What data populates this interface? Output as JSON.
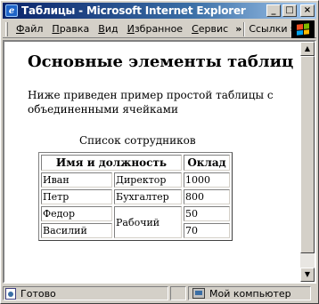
{
  "window": {
    "title": "Таблицы - Microsoft Internet Explorer",
    "minimize": "_",
    "maximize": "□",
    "close": "×"
  },
  "menu": {
    "items": [
      {
        "underline": "Ф",
        "rest": "айл"
      },
      {
        "underline": "П",
        "rest": "равка"
      },
      {
        "underline": "В",
        "rest": "ид"
      },
      {
        "underline": "И",
        "rest": "збранное"
      },
      {
        "underline": "С",
        "rest": "ервис"
      }
    ],
    "chevron": "»",
    "links_label": "Ссылки",
    "links_chevron": "»"
  },
  "page": {
    "heading": "Основные элементы таблиц",
    "intro": "Ниже приведен пример простой таблицы с объединенными ячейками",
    "table_caption": "Список сотрудников",
    "headers": [
      "Имя и должность",
      "Оклад"
    ],
    "rows": [
      {
        "name": "Иван",
        "position": "Директор",
        "salary": "1000"
      },
      {
        "name": "Петр",
        "position": "Бухгалтер",
        "salary": "800"
      },
      {
        "name": "Федор",
        "position": "Рабочий",
        "salary": "50"
      },
      {
        "name": "Василий",
        "position": "",
        "salary": "70"
      }
    ]
  },
  "status": {
    "text": "Готово",
    "zone": "Мой компьютер"
  },
  "scrollbar": {
    "up": "▲",
    "down": "▼"
  }
}
